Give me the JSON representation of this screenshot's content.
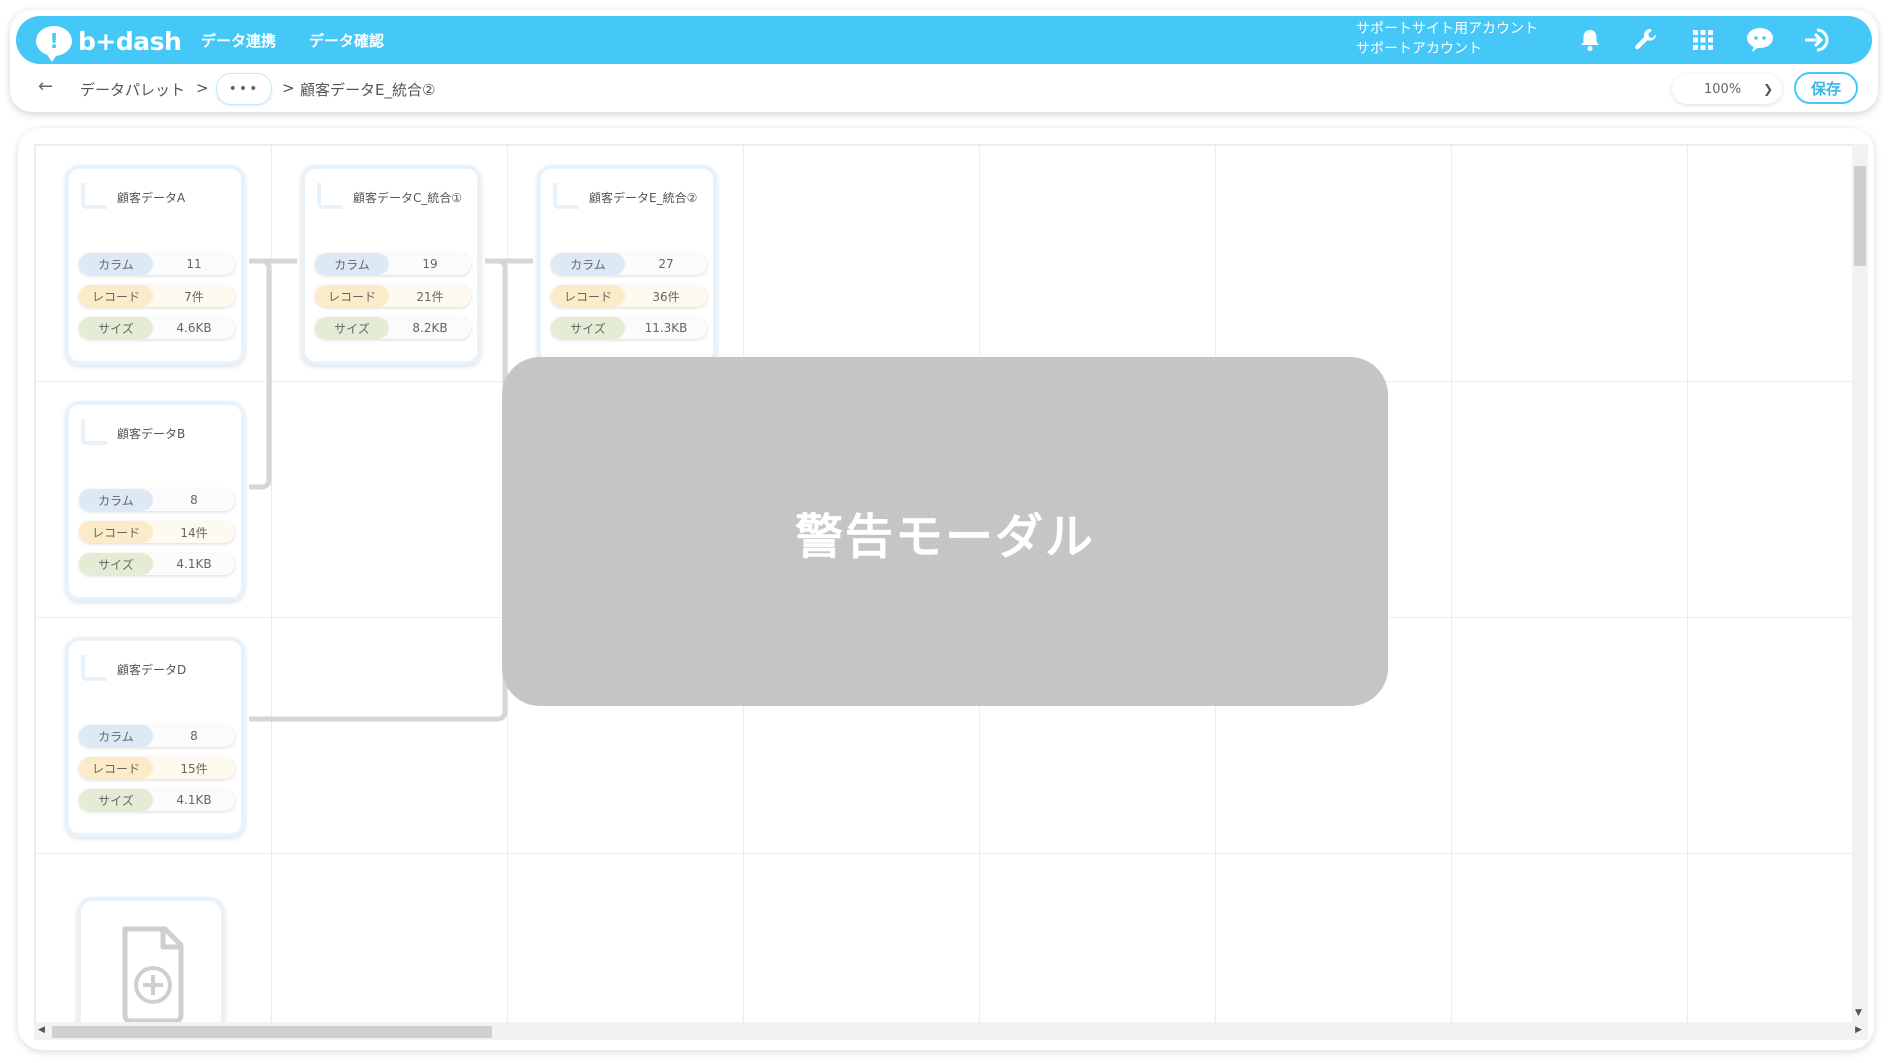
{
  "app": {
    "logo_text": "b+dash",
    "logo_mark": "!",
    "brand_color": "#45c8f7"
  },
  "nav": {
    "items": [
      {
        "label": "データ連携"
      },
      {
        "label": "データ確認"
      }
    ]
  },
  "account": {
    "site": "サポートサイト用アカウント",
    "user": "サポートアカウント"
  },
  "header_icons": [
    "bell-icon",
    "wrench-icon",
    "grid-icon",
    "chat-icon",
    "logout-icon"
  ],
  "breadcrumb": {
    "back_icon": "←",
    "root": "データパレット",
    "separator": ">",
    "more": "•••",
    "current": "顧客データE_統合②"
  },
  "toolbar": {
    "zoom": "100%",
    "save_label": "保存"
  },
  "stat_labels": {
    "columns": "カラム",
    "records": "レコード",
    "size": "サイズ"
  },
  "cards": [
    {
      "title": "顧客データA",
      "columns": "11",
      "records": "7件",
      "size": "4.6KB"
    },
    {
      "title": "顧客データC_統合①",
      "columns": "19",
      "records": "21件",
      "size": "8.2KB"
    },
    {
      "title": "顧客データE_統合②",
      "columns": "27",
      "records": "36件",
      "size": "11.3KB"
    },
    {
      "title": "顧客データB",
      "columns": "8",
      "records": "14件",
      "size": "4.1KB"
    },
    {
      "title": "顧客データD",
      "columns": "8",
      "records": "15件",
      "size": "4.1KB"
    }
  ],
  "modal": {
    "title": "警告モーダル"
  }
}
